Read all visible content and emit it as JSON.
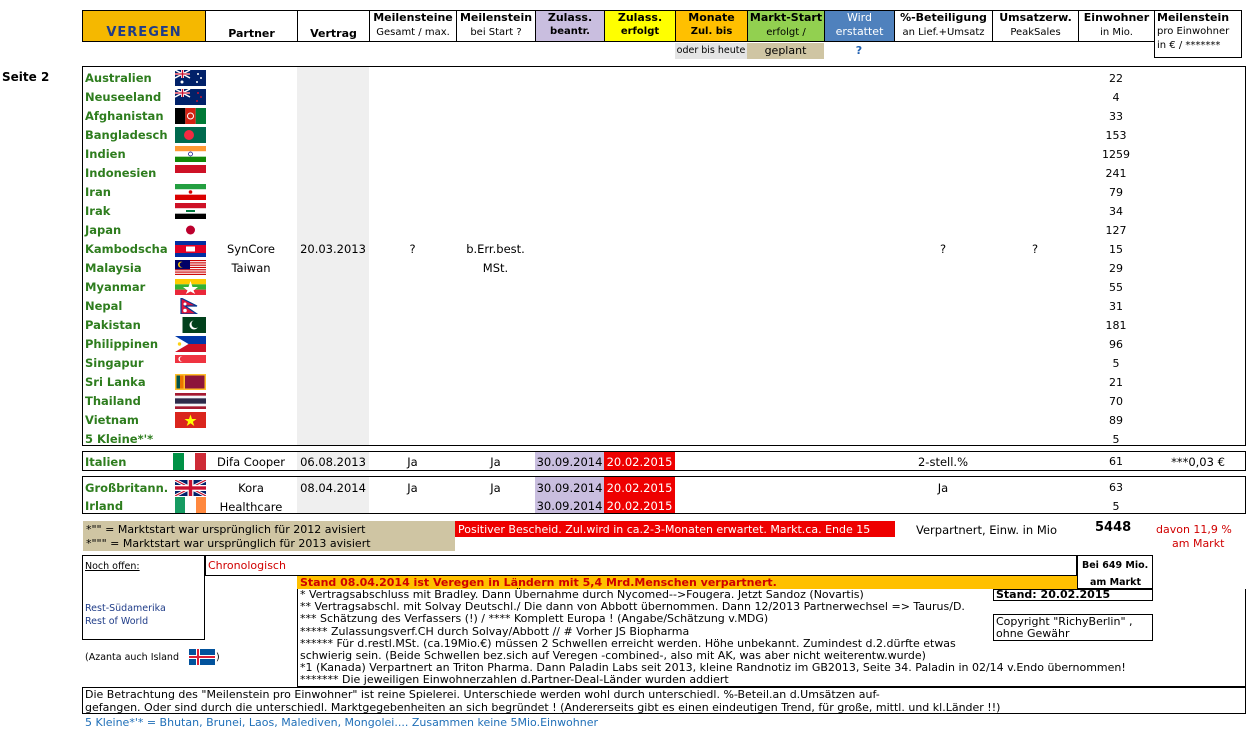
{
  "header": {
    "veregen": "VEREGEN",
    "partner": "Partner",
    "vertrag": "Vertrag",
    "meilensteine_title": "Meilensteine",
    "meilensteine_sub": "Gesamt / max.",
    "meilenstein_start_title": "Meilenstein",
    "meilenstein_start_sub": "bei Start ?",
    "zul_beantr_title": "Zulass.",
    "zul_beantr_sub": "beantr.",
    "zul_erfolgt_title": "Zulass.",
    "zul_erfolgt_sub": "erfolgt",
    "monate_title": "Monate",
    "monate_sub": "Zul. bis Start",
    "monate_sub2": "oder bis heute",
    "markt_title": "Markt-Start",
    "markt_sub": "erfolgt /",
    "markt_sub2": "geplant",
    "wird_title": "Wird",
    "wird_sub": "erstattet",
    "wird_q": "?",
    "beteil_title": "%-Beteiligung",
    "beteil_sub": "an Lief.+Umsatz",
    "umsatz_title": "Umsatzerw.",
    "umsatz_sub": "PeakSales",
    "einw_title": "Einwohner",
    "einw_sub": "in Mio.",
    "proeinw_title": "Meilenstein",
    "proeinw_sub": "pro Einwohner",
    "proeinw_sub2": "in € / *******"
  },
  "page_label": "Seite 2",
  "asia": {
    "countries": [
      {
        "name": "Australien",
        "pop": "22",
        "flag": "au"
      },
      {
        "name": "Neuseeland",
        "pop": "4",
        "flag": "nz"
      },
      {
        "name": "Afghanistan",
        "pop": "33",
        "flag": "af"
      },
      {
        "name": "Bangladesch",
        "pop": "153",
        "flag": "bd"
      },
      {
        "name": "Indien",
        "pop": "1259",
        "flag": "in"
      },
      {
        "name": "Indonesien",
        "pop": "241",
        "flag": "id"
      },
      {
        "name": "Iran",
        "pop": "79",
        "flag": "ir"
      },
      {
        "name": "Irak",
        "pop": "34",
        "flag": "iq"
      },
      {
        "name": "Japan",
        "pop": "127",
        "flag": "jp"
      },
      {
        "name": "Kambodscha",
        "pop": "15",
        "flag": "kh"
      },
      {
        "name": "Malaysia",
        "pop": "29",
        "flag": "my"
      },
      {
        "name": "Myanmar",
        "pop": "55",
        "flag": "mm"
      },
      {
        "name": "Nepal",
        "pop": "31",
        "flag": "np"
      },
      {
        "name": "Pakistan",
        "pop": "181",
        "flag": "pk"
      },
      {
        "name": "Philippinen",
        "pop": "96",
        "flag": "ph"
      },
      {
        "name": "Singapur",
        "pop": "5",
        "flag": "sg"
      },
      {
        "name": "Sri Lanka",
        "pop": "21",
        "flag": "lk"
      },
      {
        "name": "Thailand",
        "pop": "70",
        "flag": "th"
      },
      {
        "name": "Vietnam",
        "pop": "89",
        "flag": "vn"
      },
      {
        "name": "5 Kleine*'*",
        "pop": "5",
        "flag": ""
      }
    ],
    "partner": "SynCore",
    "partner2": "Taiwan",
    "vertrag": "20.03.2013",
    "meilensteine": "?",
    "meilenstein_start": "b.Err.best.",
    "meilenstein_start2": "MSt.",
    "beteiligung": "?",
    "umsatz": "?"
  },
  "italien": {
    "name": "Italien",
    "partner": "Difa Cooper",
    "vertrag": "06.08.2013",
    "meilensteine": "Ja",
    "meilenstein_start": "Ja",
    "zul_beantr": "30.09.2014",
    "zul_erfolgt": "20.02.2015",
    "beteiligung": "2-stell.%",
    "pop": "61",
    "proeinw": "***0,03 €"
  },
  "uk": {
    "name": "Großbritann.",
    "name2": "Irland",
    "partner": "Kora",
    "partner2": "Healthcare",
    "vertrag": "08.04.2014",
    "meilensteine": "Ja",
    "meilenstein_start": "Ja",
    "zul_beantr": "30.09.2014",
    "zul_erfolgt": "20.02.2015",
    "zul_beantr2": "30.09.2014",
    "zul_erfolgt2": "20.02.2015",
    "beteiligung": "Ja",
    "pop": "63",
    "pop2": "5"
  },
  "notes": {
    "star1": "*\"\"  = Marktstart war ursprünglich für 2012 avisiert",
    "star2": "*\"\"\" = Marktstart war ursprünglich für 2013 avisiert",
    "positive": "Positiver Bescheid. Zul.wird in ca.2-3-Monaten erwartet. Markt.ca. Ende 15",
    "verpartnert_label": "Verpartnert,  Einw. in Mio",
    "verpartnert_total": "5448",
    "davon": "davon 11,9 %",
    "davon2": "am Markt",
    "noch_offen": "Noch offen:",
    "chronologisch": "Chronologisch",
    "bei649": "Bei 649 Mio.",
    "bei649b": "am Markt",
    "stand_banner": "Stand 08.04.2014 ist Veregen in Ländern mit 5,4 Mrd.Menschen verpartnert.",
    "stand_date": "Stand: 20.02.2015",
    "copyright": "Copyright \"RichyBerlin\" ,",
    "copyright2": "ohne Gewähr",
    "rest1": "Rest-Südamerika",
    "rest2": "Rest of World",
    "azanta": "(Azanta auch Island",
    "azanta_close": ")",
    "lines": [
      "* Vertragsabschluss mit Bradley. Dann Übernahme durch Nycomed-->Fougera. Jetzt Sandoz (Novartis)",
      "** Vertragsabschl. mit Solvay Deutschl./ Die dann von Abbott übernommen. Dann 12/2013 Partnerwechsel => Taurus/D.",
      "*** Schätzung des Verfassers (!)   /    **** Komplett Europa ! (Angabe/Schätzung v.MDG)",
      "***** Zulassungsverf.CH durch Solvay/Abbott          //      # Vorher JS Biopharma",
      "****** Für d.restl.MSt. (ca.19Mio.€) müssen 2 Schwellen erreicht werden. Höhe unbekannt. Zumindest d.2.dürfte etwas",
      "schwierig sein. (Beide Schwellen bez.sich auf Veregen -combined-, also mit AK, was aber nicht weiterentw.wurde)",
      "*1 (Kanada) Verpartnert an Triton Pharma. Dann Paladin Labs seit 2013, kleine Randnotiz im GB2013, Seite 34. Paladin in 02/14 v.Endo übernommen!",
      "******* Die jeweiligen Einwohnerzahlen d.Partner-Deal-Länder wurden addiert"
    ],
    "betrachtung1": "Die Betrachtung des \"Meilenstein pro Einwohner\" ist reine Spielerei. Unterschiede werden wohl durch unterschiedl. %-Beteil.an d.Umsätzen auf-",
    "betrachtung2": "gefangen. Oder sind durch die unterschiedl. Marktgegebenheiten an sich begründet ! (Andererseits gibt es einen eindeutigen Trend, für große, mittl. und kl.Länder !!)",
    "kleine": "5 Kleine*'* = Bhutan, Brunei, Laos, Malediven, Mongolei.... Zusammen keine 5Mio.Einwohner"
  },
  "colors": {
    "veregen_bg": "#f5b800",
    "zul_beantr_bg": "#c9bedf",
    "zul_erfolgt_bg": "#ffff00",
    "monate_bg": "#ffc000",
    "markt_bg": "#92d050",
    "wird_bg": "#4f81bd",
    "vertrag_col": "#efefef",
    "note_bg": "#cfc5a3",
    "red_bg": "#ee0000",
    "country_green": "#2e7d1e"
  }
}
